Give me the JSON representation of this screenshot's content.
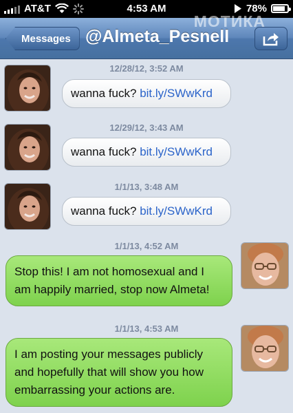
{
  "status_bar": {
    "carrier": "AT&T",
    "time": "4:53 AM",
    "battery": "78%",
    "battery_level": 0.78
  },
  "watermark": "МОТИКА",
  "nav": {
    "back_label": "Messages",
    "title": "@Almeta_Pesnell"
  },
  "messages": [
    {
      "timestamp": "12/28/12, 3:52 AM",
      "direction": "incoming",
      "text": "wanna fuck? ",
      "link": "bit.ly/SWwKrd"
    },
    {
      "timestamp": "12/29/12, 3:43 AM",
      "direction": "incoming",
      "text": "wanna fuck? ",
      "link": "bit.ly/SWwKrd"
    },
    {
      "timestamp": "1/1/13, 3:48 AM",
      "direction": "incoming",
      "text": "wanna fuck? ",
      "link": "bit.ly/SWwKrd"
    },
    {
      "timestamp": "1/1/13, 4:52 AM",
      "direction": "outgoing",
      "text": "Stop this! I am not homosexual and I am happily married, stop now Almeta!"
    },
    {
      "timestamp": "1/1/13, 4:53 AM",
      "direction": "outgoing",
      "text": "I am posting your messages publicly and hopefully that will show you how embarrassing your actions are."
    }
  ]
}
